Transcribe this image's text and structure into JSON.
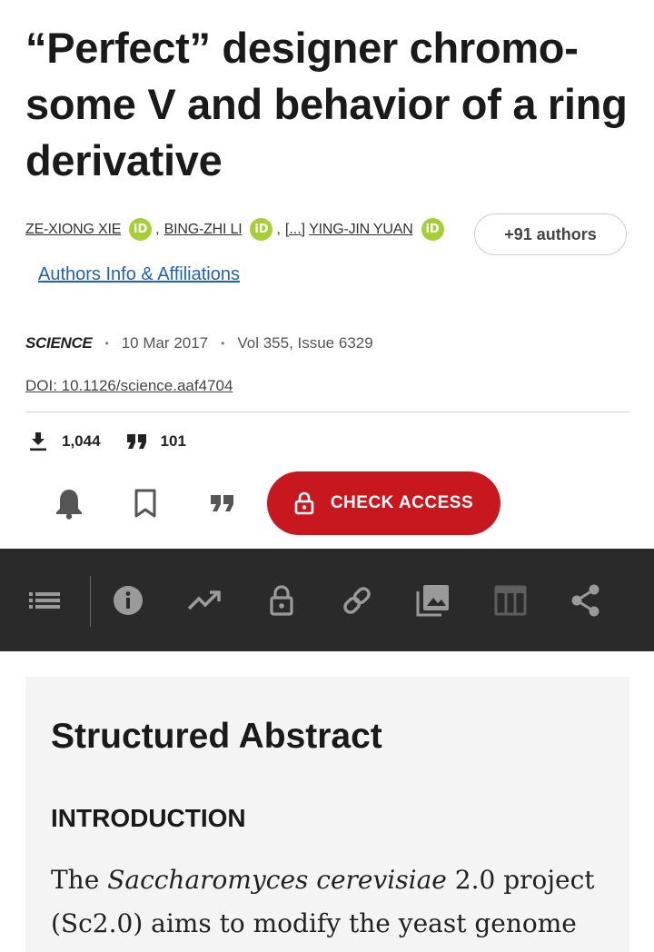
{
  "article": {
    "title": "“Perfect” designer chromo-some V and behavior of a ring derivative"
  },
  "authors": {
    "list": [
      {
        "name": "ZE-XIONG XIE",
        "orcid_badge": "iD"
      },
      {
        "name": "BING-ZHI LI",
        "orcid_badge": "iD"
      },
      {
        "name": "YING-JIN YUAN",
        "orcid_badge": "iD"
      }
    ],
    "separator": ",",
    "ellipsis": "[...]",
    "more_button": "+91 authors",
    "affiliations_link": "Authors Info & Affiliations"
  },
  "meta": {
    "journal": "SCIENCE",
    "date": "10 Mar 2017",
    "volume": "Vol 355, Issue 6329",
    "bullet": "•",
    "doi": "DOI: 10.1126/science.aaf4704"
  },
  "metrics": {
    "downloads": "1,044",
    "citations": "101"
  },
  "actions": {
    "check_access": "CHECK ACCESS",
    "icons": [
      "bell-icon",
      "bookmark-icon",
      "quote-icon"
    ]
  },
  "toolbar": {
    "icons": [
      "list-icon",
      "info-icon",
      "trending-icon",
      "lock-icon",
      "link-icon",
      "images-icon",
      "table-icon",
      "share-icon"
    ]
  },
  "abstract": {
    "heading": "Structured Abstract",
    "section": "INTRODUCTION",
    "text_pre": "The ",
    "text_italic": "Saccharomyces cerevisiae",
    "text_post": " 2.0 project (Sc2.0) aims to modify the yeast genome"
  },
  "colors": {
    "accent_red": "#c8171e",
    "link_blue": "#1e63b3",
    "orcid_green": "#a6ce39",
    "toolbar_bg": "#2a2a2a",
    "abstract_bg": "#f4f4f4"
  }
}
